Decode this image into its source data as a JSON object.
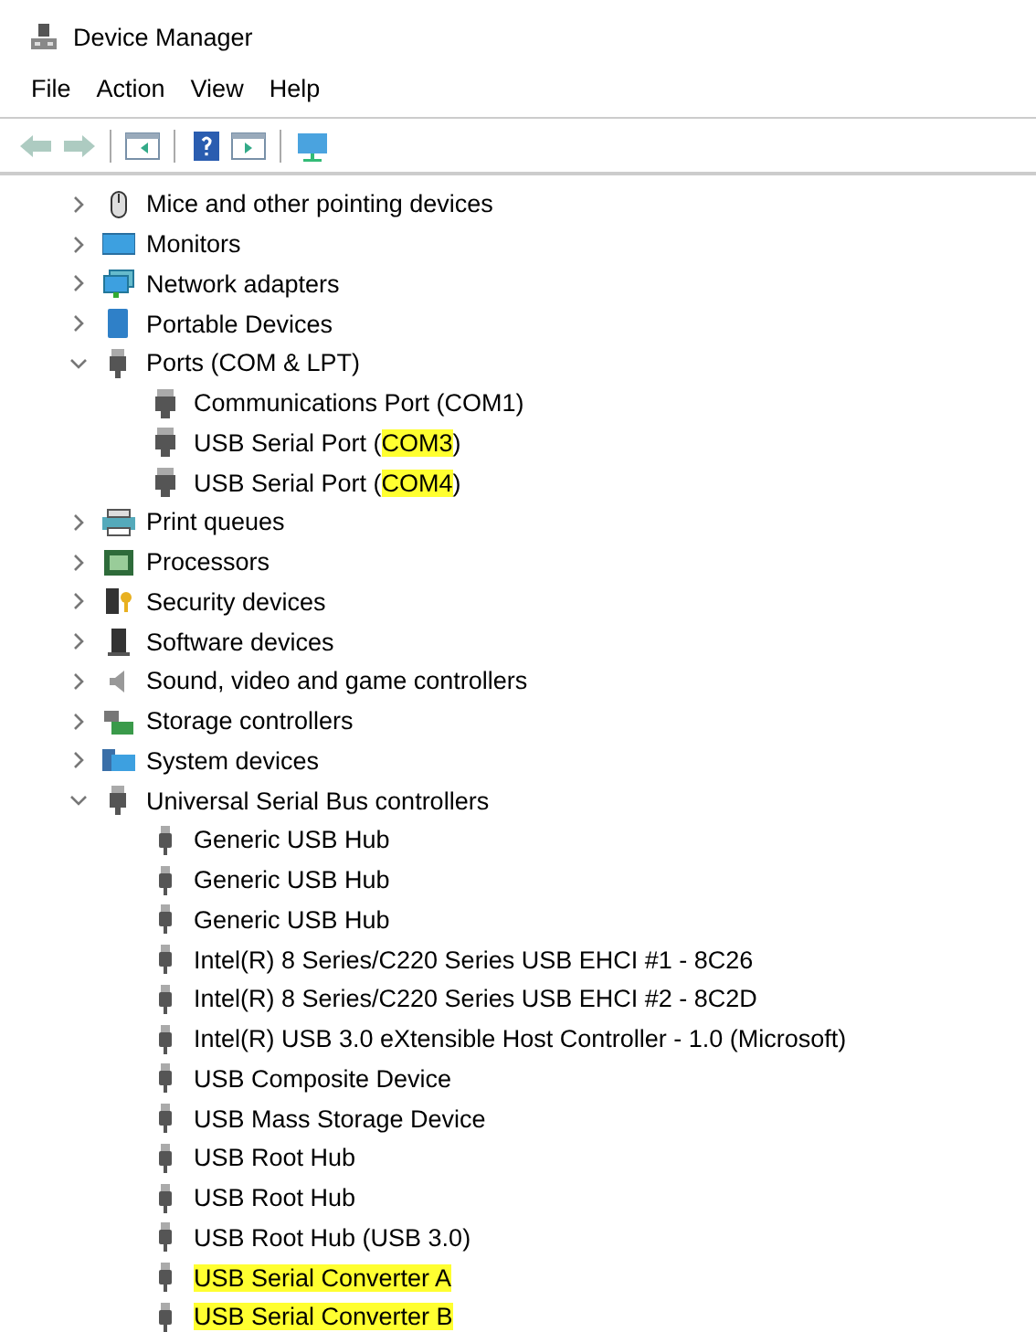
{
  "window": {
    "title": "Device Manager"
  },
  "menu": [
    "File",
    "Action",
    "View",
    "Help"
  ],
  "toolbar": [
    {
      "kind": "back",
      "disabled": true
    },
    {
      "kind": "forward",
      "disabled": true
    },
    {
      "kind": "sep"
    },
    {
      "kind": "panel-left",
      "disabled": false
    },
    {
      "kind": "sep"
    },
    {
      "kind": "help",
      "disabled": false
    },
    {
      "kind": "panel-right",
      "disabled": false
    },
    {
      "kind": "sep"
    },
    {
      "kind": "monitor-net",
      "disabled": false
    }
  ],
  "tree": [
    {
      "label": "Mice and other pointing devices",
      "kind": "mouse",
      "expanded": false
    },
    {
      "label": "Monitors",
      "kind": "monitor",
      "expanded": false
    },
    {
      "label": "Network adapters",
      "kind": "network",
      "expanded": false
    },
    {
      "label": "Portable Devices",
      "kind": "portable",
      "expanded": false
    },
    {
      "label": "Ports (COM & LPT)",
      "kind": "port",
      "expanded": true,
      "children": [
        {
          "parts": [
            {
              "text": "Communications Port (COM1)",
              "highlighted": false
            }
          ],
          "kind": "port"
        },
        {
          "parts": [
            {
              "text": "USB Serial Port (",
              "highlighted": false
            },
            {
              "text": "COM3",
              "highlighted": true
            },
            {
              "text": ")",
              "highlighted": false
            }
          ],
          "kind": "port"
        },
        {
          "parts": [
            {
              "text": "USB Serial Port (",
              "highlighted": false
            },
            {
              "text": "COM4",
              "highlighted": true
            },
            {
              "text": ")",
              "highlighted": false
            }
          ],
          "kind": "port"
        }
      ]
    },
    {
      "label": "Print queues",
      "kind": "printer",
      "expanded": false
    },
    {
      "label": "Processors",
      "kind": "chip",
      "expanded": false
    },
    {
      "label": "Security devices",
      "kind": "security",
      "expanded": false
    },
    {
      "label": "Software devices",
      "kind": "software",
      "expanded": false
    },
    {
      "label": "Sound, video and game controllers",
      "kind": "speaker",
      "expanded": false
    },
    {
      "label": "Storage controllers",
      "kind": "storage",
      "expanded": false
    },
    {
      "label": "System devices",
      "kind": "system",
      "expanded": false
    },
    {
      "label": "Universal Serial Bus controllers",
      "kind": "usb",
      "expanded": true,
      "children": [
        {
          "parts": [
            {
              "text": "Generic USB Hub",
              "highlighted": false
            }
          ],
          "kind": "usb"
        },
        {
          "parts": [
            {
              "text": "Generic USB Hub",
              "highlighted": false
            }
          ],
          "kind": "usb"
        },
        {
          "parts": [
            {
              "text": "Generic USB Hub",
              "highlighted": false
            }
          ],
          "kind": "usb"
        },
        {
          "parts": [
            {
              "text": "Intel(R) 8 Series/C220 Series USB EHCI #1 - 8C26",
              "highlighted": false
            }
          ],
          "kind": "usb"
        },
        {
          "parts": [
            {
              "text": "Intel(R) 8 Series/C220 Series USB EHCI #2 - 8C2D",
              "highlighted": false
            }
          ],
          "kind": "usb"
        },
        {
          "parts": [
            {
              "text": "Intel(R) USB 3.0 eXtensible Host Controller - 1.0 (Microsoft)",
              "highlighted": false
            }
          ],
          "kind": "usb"
        },
        {
          "parts": [
            {
              "text": "USB Composite Device",
              "highlighted": false
            }
          ],
          "kind": "usb"
        },
        {
          "parts": [
            {
              "text": "USB Mass Storage Device",
              "highlighted": false
            }
          ],
          "kind": "usb"
        },
        {
          "parts": [
            {
              "text": "USB Root Hub",
              "highlighted": false
            }
          ],
          "kind": "usb"
        },
        {
          "parts": [
            {
              "text": "USB Root Hub",
              "highlighted": false
            }
          ],
          "kind": "usb"
        },
        {
          "parts": [
            {
              "text": "USB Root Hub (USB 3.0)",
              "highlighted": false
            }
          ],
          "kind": "usb"
        },
        {
          "parts": [
            {
              "text": "USB Serial Converter A",
              "highlighted": true
            }
          ],
          "kind": "usb"
        },
        {
          "parts": [
            {
              "text": "USB Serial Converter B",
              "highlighted": true
            }
          ],
          "kind": "usb"
        }
      ]
    }
  ]
}
